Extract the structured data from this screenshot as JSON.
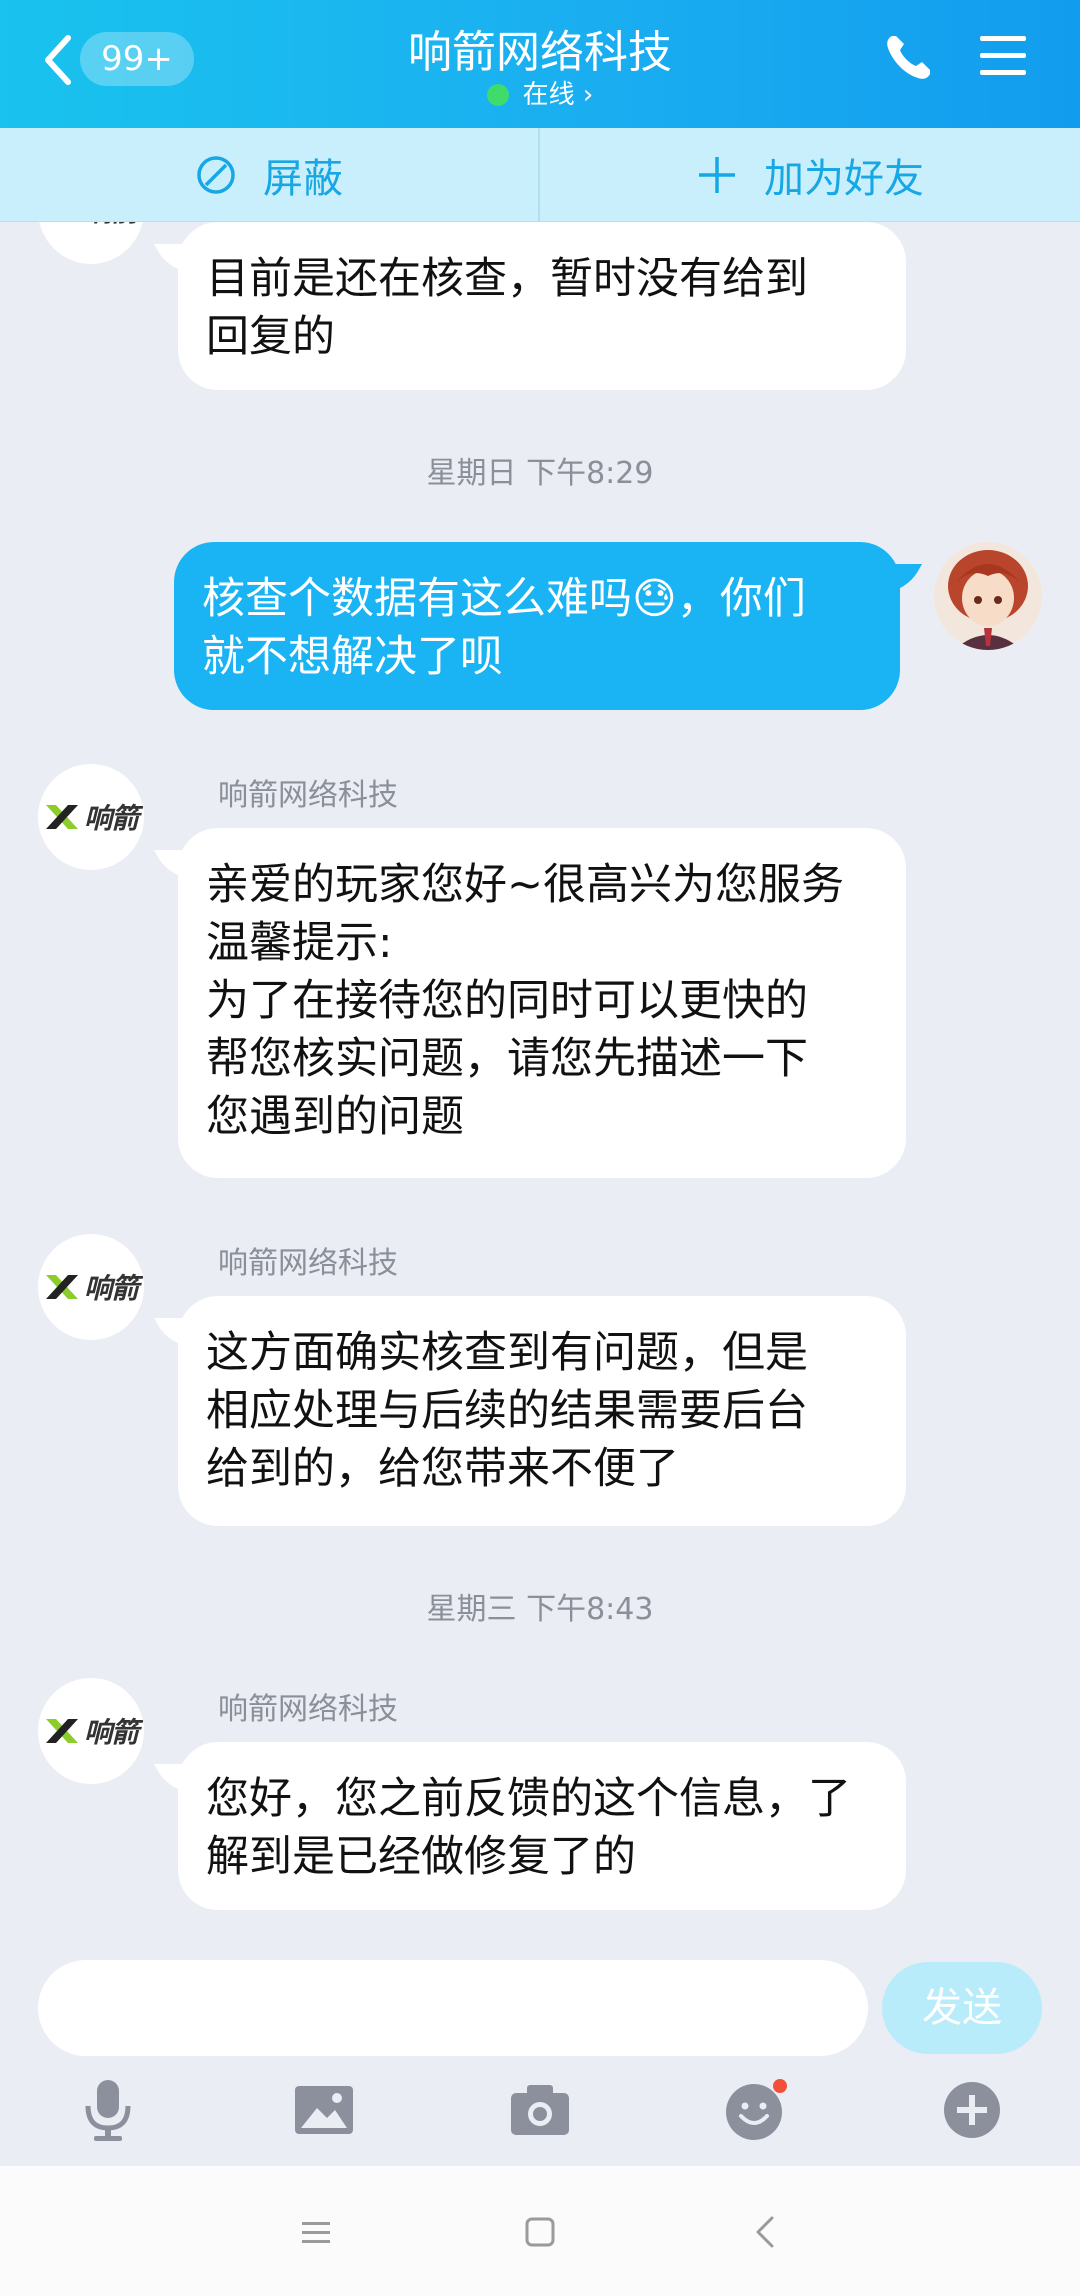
{
  "header": {
    "badge": "99+",
    "title": "响箭网络科技",
    "status": "在线 ›"
  },
  "actions": {
    "block": "屏蔽",
    "add_friend": "加为好友"
  },
  "partner": {
    "logo_text": "响箭"
  },
  "messages": [
    {
      "from": "partner",
      "lines": [
        "目前是还在核查，暂时没有给到",
        "回复的"
      ]
    },
    {
      "time": "星期日 下午8:29"
    },
    {
      "from": "me",
      "lines": [
        "核查个数据有这么难吗😓，你们",
        "就不想解决了呗"
      ]
    },
    {
      "from": "partner",
      "sender": "响箭网络科技",
      "lines": [
        "亲爱的玩家您好~很高兴为您服务",
        "温馨提示:",
        "为了在接待您的同时可以更快的",
        "帮您核实问题，请您先描述一下",
        "您遇到的问题"
      ]
    },
    {
      "from": "partner",
      "sender": "响箭网络科技",
      "lines": [
        "这方面确实核查到有问题，但是",
        "相应处理与后续的结果需要后台",
        "给到的，给您带来不便了"
      ]
    },
    {
      "time": "星期三 下午8:43"
    },
    {
      "from": "partner",
      "sender": "响箭网络科技",
      "lines": [
        "您好，您之前反馈的这个信息，了",
        "解到是已经做修复了的"
      ]
    }
  ],
  "composer": {
    "send_label": "发送"
  }
}
